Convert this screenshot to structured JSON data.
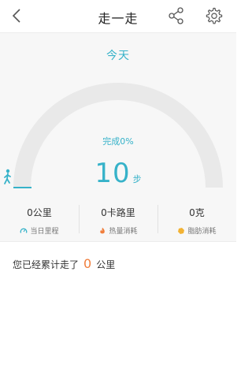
{
  "header": {
    "title": "走一走",
    "back_icon": "chevron-left-icon",
    "share_icon": "share-icon",
    "settings_icon": "gear-icon"
  },
  "card": {
    "period_label": "今天",
    "progress_text": "完成0%",
    "progress_fraction": 0,
    "steps": "10",
    "steps_unit": "步"
  },
  "stats": [
    {
      "value": "0公里",
      "label": "当日里程",
      "icon": "odometer-icon",
      "color": "#36b2c9"
    },
    {
      "value": "0卡路里",
      "label": "热量消耗",
      "icon": "flame-icon",
      "color": "#f07e3c"
    },
    {
      "value": "0克",
      "label": "脂肪消耗",
      "icon": "fat-drop-icon",
      "color": "#f2b233"
    }
  ],
  "summary": {
    "prefix": "您已经累计走了",
    "distance": "0",
    "unit": "公里"
  },
  "colors": {
    "accent": "#36b2c9",
    "orange": "#f07e3c",
    "gauge_track": "#e9e9e9"
  }
}
